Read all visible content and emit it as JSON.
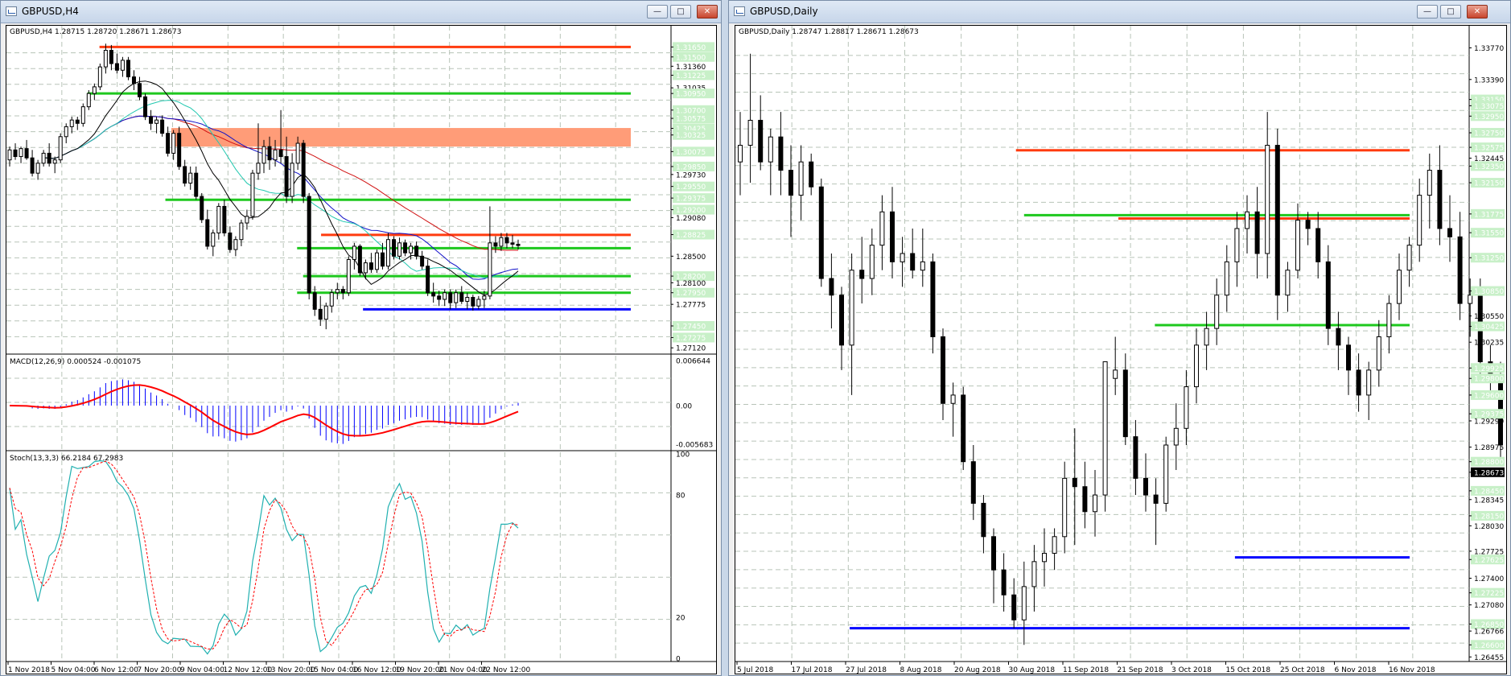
{
  "colors": {
    "bull": "#ffffff",
    "bear": "#000000",
    "resistance": "#ff3b0f",
    "support_green": "#1ec81e",
    "support_blue": "#0000ff",
    "zone": "#ff9c78",
    "grid": "#b8c4b8",
    "price_label_bg": "#c8f0c8",
    "ma_black": "#000000",
    "ma_blue": "#1010c8",
    "ma_red": "#d01010",
    "ma_teal": "#22c8b0",
    "macd_hist": "#0000ff",
    "macd_signal": "#ff0000",
    "stoch_main": "#20b0b0",
    "stoch_signal": "#ff0000"
  },
  "left": {
    "window_title": "GBPUSD,H4",
    "buttons": {
      "minimize": "—",
      "maximize": "□",
      "close": "✕"
    },
    "chart_header": "GBPUSD,H4  1.28715 1.28720 1.28671 1.28673",
    "macd_header": "MACD(12,26,9) 0.000524 -0.001075",
    "stoch_header": "Stoch(13,3,3) 66.2184 67.2983",
    "price_labels": [
      "1.31650",
      "1.31500",
      "1.31360",
      "1.31225",
      "1.31035",
      "1.30950",
      "1.30700",
      "1.30575",
      "1.30425",
      "1.30325",
      "1.30075",
      "1.29850",
      "1.29730",
      "1.29550",
      "1.29375",
      "1.29200",
      "1.29080",
      "1.28825",
      "1.28500",
      "1.28200",
      "1.28100",
      "1.27950",
      "1.27775",
      "1.27450",
      "1.27275",
      "1.27120"
    ],
    "price_labels_hl": [
      0,
      1,
      3,
      5,
      6,
      7,
      8,
      9,
      10,
      11,
      13,
      14,
      15,
      17,
      19,
      21,
      23,
      24
    ],
    "price_range": [
      1.2705,
      1.318
    ],
    "current_price": 1.28673,
    "macd_labels": [
      "0.006644",
      "0.00",
      "-0.005683"
    ],
    "stoch_labels": [
      "100",
      "80",
      "20",
      "0"
    ],
    "x_labels": [
      "1 Nov 2018",
      "5 Nov 04:00",
      "6 Nov 12:00",
      "7 Nov 20:00",
      "9 Nov 04:00",
      "12 Nov 12:00",
      "13 Nov 20:00",
      "15 Nov 04:00",
      "16 Nov 12:00",
      "19 Nov 20:00",
      "21 Nov 04:00",
      "22 Nov 12:00"
    ],
    "hlines": [
      {
        "price": 1.3165,
        "color": "resistance",
        "from": 0.3
      },
      {
        "price": 1.3095,
        "color": "support_green",
        "from": 0.26
      },
      {
        "price": 1.2935,
        "color": "support_green",
        "from": 0.52
      },
      {
        "price": 1.2882,
        "color": "resistance",
        "from": 1.04
      },
      {
        "price": 1.2862,
        "color": "support_green",
        "from": 0.96
      },
      {
        "price": 1.282,
        "color": "support_green",
        "from": 0.98
      },
      {
        "price": 1.2795,
        "color": "support_green",
        "from": 0.96
      },
      {
        "price": 1.277,
        "color": "support_blue",
        "from": 1.18
      }
    ],
    "zone": {
      "from": 1.3043,
      "to": 1.3015,
      "start": 0.54
    },
    "candles": [
      [
        1.2995,
        1.3015,
        1.2985,
        1.301
      ],
      [
        1.301,
        1.302,
        1.2995,
        1.3
      ],
      [
        1.3,
        1.3015,
        1.299,
        1.3012
      ],
      [
        1.3012,
        1.3025,
        1.2995,
        1.2998
      ],
      [
        1.2998,
        1.301,
        1.297,
        1.2975
      ],
      [
        1.2975,
        1.2995,
        1.2965,
        1.299
      ],
      [
        1.299,
        1.301,
        1.2985,
        1.3005
      ],
      [
        1.3005,
        1.302,
        1.2985,
        1.299
      ],
      [
        1.299,
        1.3,
        1.2975,
        1.2995
      ],
      [
        1.2995,
        1.3035,
        1.299,
        1.303
      ],
      [
        1.303,
        1.305,
        1.302,
        1.3045
      ],
      [
        1.3045,
        1.306,
        1.3035,
        1.3055
      ],
      [
        1.3055,
        1.306,
        1.304,
        1.305
      ],
      [
        1.305,
        1.308,
        1.3045,
        1.3075
      ],
      [
        1.3075,
        1.31,
        1.307,
        1.3095
      ],
      [
        1.3095,
        1.311,
        1.3085,
        1.3105
      ],
      [
        1.3105,
        1.314,
        1.31,
        1.3135
      ],
      [
        1.3135,
        1.317,
        1.3125,
        1.316
      ],
      [
        1.316,
        1.3168,
        1.313,
        1.314
      ],
      [
        1.314,
        1.3155,
        1.3125,
        1.313
      ],
      [
        1.313,
        1.315,
        1.312,
        1.3145
      ],
      [
        1.3145,
        1.315,
        1.3115,
        1.312
      ],
      [
        1.312,
        1.313,
        1.31,
        1.311
      ],
      [
        1.311,
        1.312,
        1.3085,
        1.309
      ],
      [
        1.309,
        1.3095,
        1.3055,
        1.306
      ],
      [
        1.306,
        1.307,
        1.304,
        1.305
      ],
      [
        1.305,
        1.306,
        1.3035,
        1.3055
      ],
      [
        1.3055,
        1.3062,
        1.303,
        1.3035
      ],
      [
        1.3035,
        1.3045,
        1.3,
        1.3005
      ],
      [
        1.3005,
        1.304,
        1.2995,
        1.3035
      ],
      [
        1.3035,
        1.3045,
        1.298,
        1.2985
      ],
      [
        1.2985,
        1.2995,
        1.2955,
        1.296
      ],
      [
        1.296,
        1.2985,
        1.295,
        1.2975
      ],
      [
        1.2975,
        1.2985,
        1.2935,
        1.294
      ],
      [
        1.294,
        1.2945,
        1.29,
        1.2905
      ],
      [
        1.2905,
        1.292,
        1.286,
        1.2865
      ],
      [
        1.2865,
        1.289,
        1.285,
        1.2885
      ],
      [
        1.2885,
        1.293,
        1.2875,
        1.2925
      ],
      [
        1.2925,
        1.2935,
        1.288,
        1.2885
      ],
      [
        1.2885,
        1.2895,
        1.2855,
        1.286
      ],
      [
        1.286,
        1.288,
        1.285,
        1.2875
      ],
      [
        1.2875,
        1.2905,
        1.2865,
        1.29
      ],
      [
        1.29,
        1.292,
        1.289,
        1.291
      ],
      [
        1.291,
        1.298,
        1.2905,
        1.2975
      ],
      [
        1.2975,
        1.305,
        1.2965,
        1.299
      ],
      [
        1.299,
        1.3025,
        1.2975,
        1.3015
      ],
      [
        1.3015,
        1.303,
        1.298,
        1.2995
      ],
      [
        1.2995,
        1.3025,
        1.2985,
        1.301
      ],
      [
        1.301,
        1.307,
        1.299,
        1.3
      ],
      [
        1.3,
        1.303,
        1.293,
        1.294
      ],
      [
        1.294,
        1.3005,
        1.293,
        1.299
      ],
      [
        1.299,
        1.303,
        1.298,
        1.302
      ],
      [
        1.302,
        1.3025,
        1.293,
        1.294
      ],
      [
        1.294,
        1.2945,
        1.2785,
        1.2795
      ],
      [
        1.2795,
        1.2805,
        1.276,
        1.277
      ],
      [
        1.277,
        1.279,
        1.2745,
        1.2755
      ],
      [
        1.2755,
        1.278,
        1.274,
        1.2775
      ],
      [
        1.2775,
        1.28,
        1.2765,
        1.2795
      ],
      [
        1.2795,
        1.281,
        1.2785,
        1.28
      ],
      [
        1.28,
        1.2805,
        1.2785,
        1.2795
      ],
      [
        1.2795,
        1.285,
        1.279,
        1.2845
      ],
      [
        1.2845,
        1.287,
        1.283,
        1.2865
      ],
      [
        1.2865,
        1.2868,
        1.282,
        1.2825
      ],
      [
        1.2825,
        1.2845,
        1.2815,
        1.284
      ],
      [
        1.284,
        1.2855,
        1.2825,
        1.283
      ],
      [
        1.283,
        1.286,
        1.2825,
        1.2855
      ],
      [
        1.2855,
        1.287,
        1.283,
        1.2835
      ],
      [
        1.2835,
        1.2885,
        1.283,
        1.2875
      ],
      [
        1.2875,
        1.288,
        1.2845,
        1.285
      ],
      [
        1.285,
        1.2878,
        1.2845,
        1.287
      ],
      [
        1.287,
        1.2875,
        1.285,
        1.2855
      ],
      [
        1.2855,
        1.287,
        1.2845,
        1.2865
      ],
      [
        1.2865,
        1.2872,
        1.2845,
        1.285
      ],
      [
        1.285,
        1.2858,
        1.283,
        1.2835
      ],
      [
        1.2835,
        1.2845,
        1.279,
        1.2795
      ],
      [
        1.2795,
        1.281,
        1.278,
        1.279
      ],
      [
        1.279,
        1.2798,
        1.2775,
        1.2785
      ],
      [
        1.2785,
        1.28,
        1.2775,
        1.2795
      ],
      [
        1.2795,
        1.28,
        1.277,
        1.278
      ],
      [
        1.278,
        1.28,
        1.2772,
        1.2795
      ],
      [
        1.2795,
        1.2805,
        1.2778,
        1.2782
      ],
      [
        1.2782,
        1.2795,
        1.277,
        1.2788
      ],
      [
        1.2788,
        1.2792,
        1.2768,
        1.2775
      ],
      [
        1.2775,
        1.279,
        1.277,
        1.2785
      ],
      [
        1.2785,
        1.2798,
        1.2772,
        1.279
      ],
      [
        1.279,
        1.2925,
        1.2785,
        1.287
      ],
      [
        1.287,
        1.288,
        1.2855,
        1.2865
      ],
      [
        1.2865,
        1.2885,
        1.2858,
        1.2878
      ],
      [
        1.2878,
        1.2885,
        1.2862,
        1.287
      ],
      [
        1.287,
        1.2882,
        1.2862,
        1.2868
      ],
      [
        1.2868,
        1.2875,
        1.286,
        1.2866
      ]
    ]
  },
  "right": {
    "window_title": "GBPUSD,Daily",
    "buttons": {
      "minimize": "—",
      "maximize": "□",
      "close": "✕"
    },
    "chart_header": "GBPUSD,Daily  1.28747 1.28817 1.28671 1.28673",
    "price_labels": [
      "1.33770",
      "1.33390",
      "1.33150",
      "1.33075",
      "1.32950",
      "1.32750",
      "1.32575",
      "1.32445",
      "1.32350",
      "1.32150",
      "1.31775",
      "1.31550",
      "1.31250",
      "1.30850",
      "1.30550",
      "1.30425",
      "1.30235",
      "1.29925",
      "1.29800",
      "1.29600",
      "1.29375",
      "1.29290",
      "1.28975",
      "1.28800",
      "1.28673",
      "1.28450",
      "1.28345",
      "1.28150",
      "1.28030",
      "1.27725",
      "1.27625",
      "1.27400",
      "1.27225",
      "1.27080",
      "1.26850",
      "1.26766",
      "1.26600",
      "1.26455"
    ],
    "price_labels_hl": [
      2,
      3,
      4,
      5,
      6,
      8,
      9,
      10,
      11,
      12,
      13,
      15,
      17,
      18,
      19,
      20,
      23,
      25,
      27,
      30,
      32,
      34,
      36
    ],
    "price_range": [
      1.264,
      1.339
    ],
    "current_price": 1.28673,
    "x_labels": [
      "5 Jul 2018",
      "17 Jul 2018",
      "27 Jul 2018",
      "8 Aug 2018",
      "20 Aug 2018",
      "30 Aug 2018",
      "11 Sep 2018",
      "21 Sep 2018",
      "3 Oct 2018",
      "15 Oct 2018",
      "25 Oct 2018",
      "6 Nov 2018",
      "16 Nov 2018"
    ],
    "hlines": [
      {
        "price": 1.3254,
        "color": "resistance",
        "from": 27.2
      },
      {
        "price": 1.3172,
        "color": "resistance",
        "from": 37.3
      },
      {
        "price": 1.3176,
        "color": "support_green",
        "from": 28.0
      },
      {
        "price": 1.3044,
        "color": "support_green",
        "from": 40.9
      },
      {
        "price": 1.2765,
        "color": "support_blue",
        "from": 48.8
      },
      {
        "price": 1.268,
        "color": "support_blue",
        "from": 10.8
      }
    ],
    "candles": [
      [
        1.324,
        1.33,
        1.32,
        1.326
      ],
      [
        1.326,
        1.337,
        1.3215,
        1.329
      ],
      [
        1.329,
        1.332,
        1.323,
        1.324
      ],
      [
        1.324,
        1.328,
        1.32,
        1.327
      ],
      [
        1.327,
        1.33,
        1.32,
        1.323
      ],
      [
        1.323,
        1.326,
        1.315,
        1.32
      ],
      [
        1.32,
        1.326,
        1.317,
        1.324
      ],
      [
        1.324,
        1.325,
        1.32,
        1.321
      ],
      [
        1.321,
        1.322,
        1.309,
        1.31
      ],
      [
        1.31,
        1.313,
        1.304,
        1.308
      ],
      [
        1.308,
        1.309,
        1.299,
        1.302
      ],
      [
        1.302,
        1.313,
        1.296,
        1.311
      ],
      [
        1.311,
        1.315,
        1.307,
        1.31
      ],
      [
        1.31,
        1.316,
        1.308,
        1.314
      ],
      [
        1.314,
        1.32,
        1.311,
        1.318
      ],
      [
        1.318,
        1.321,
        1.31,
        1.312
      ],
      [
        1.312,
        1.315,
        1.309,
        1.313
      ],
      [
        1.313,
        1.316,
        1.31,
        1.311
      ],
      [
        1.311,
        1.316,
        1.309,
        1.312
      ],
      [
        1.312,
        1.313,
        1.301,
        1.303
      ],
      [
        1.303,
        1.304,
        1.293,
        1.295
      ],
      [
        1.295,
        1.2975,
        1.291,
        1.296
      ],
      [
        1.296,
        1.297,
        1.287,
        1.288
      ],
      [
        1.288,
        1.29,
        1.281,
        1.283
      ],
      [
        1.283,
        1.284,
        1.277,
        1.279
      ],
      [
        1.279,
        1.28,
        1.271,
        1.275
      ],
      [
        1.275,
        1.277,
        1.27,
        1.272
      ],
      [
        1.272,
        1.274,
        1.268,
        1.269
      ],
      [
        1.269,
        1.276,
        1.266,
        1.273
      ],
      [
        1.273,
        1.278,
        1.27,
        1.276
      ],
      [
        1.276,
        1.28,
        1.273,
        1.277
      ],
      [
        1.277,
        1.28,
        1.275,
        1.279
      ],
      [
        1.279,
        1.288,
        1.277,
        1.286
      ],
      [
        1.286,
        1.292,
        1.278,
        1.285
      ],
      [
        1.285,
        1.288,
        1.28,
        1.282
      ],
      [
        1.282,
        1.287,
        1.279,
        1.284
      ],
      [
        1.284,
        1.295,
        1.282,
        1.3
      ],
      [
        1.298,
        1.303,
        1.296,
        1.299
      ],
      [
        1.299,
        1.301,
        1.29,
        1.291
      ],
      [
        1.291,
        1.293,
        1.284,
        1.286
      ],
      [
        1.286,
        1.289,
        1.282,
        1.284
      ],
      [
        1.284,
        1.286,
        1.278,
        1.283
      ],
      [
        1.283,
        1.291,
        1.282,
        1.29
      ],
      [
        1.29,
        1.295,
        1.287,
        1.292
      ],
      [
        1.292,
        1.299,
        1.29,
        1.297
      ],
      [
        1.297,
        1.304,
        1.295,
        1.302
      ],
      [
        1.302,
        1.306,
        1.299,
        1.304
      ],
      [
        1.304,
        1.31,
        1.302,
        1.308
      ],
      [
        1.308,
        1.314,
        1.306,
        1.312
      ],
      [
        1.312,
        1.318,
        1.309,
        1.316
      ],
      [
        1.316,
        1.32,
        1.313,
        1.318
      ],
      [
        1.318,
        1.321,
        1.31,
        1.313
      ],
      [
        1.313,
        1.33,
        1.31,
        1.326
      ],
      [
        1.326,
        1.328,
        1.305,
        1.308
      ],
      [
        1.308,
        1.312,
        1.306,
        1.311
      ],
      [
        1.311,
        1.319,
        1.31,
        1.317
      ],
      [
        1.317,
        1.318,
        1.314,
        1.316
      ],
      [
        1.316,
        1.318,
        1.31,
        1.312
      ],
      [
        1.312,
        1.314,
        1.302,
        1.304
      ],
      [
        1.304,
        1.306,
        1.299,
        1.302
      ],
      [
        1.302,
        1.303,
        1.296,
        1.299
      ],
      [
        1.299,
        1.301,
        1.294,
        1.296
      ],
      [
        1.296,
        1.3,
        1.293,
        1.299
      ],
      [
        1.299,
        1.305,
        1.297,
        1.303
      ],
      [
        1.303,
        1.308,
        1.301,
        1.307
      ],
      [
        1.307,
        1.313,
        1.305,
        1.311
      ],
      [
        1.311,
        1.315,
        1.309,
        1.314
      ],
      [
        1.314,
        1.322,
        1.312,
        1.32
      ],
      [
        1.32,
        1.325,
        1.316,
        1.323
      ],
      [
        1.323,
        1.326,
        1.314,
        1.316
      ],
      [
        1.316,
        1.32,
        1.312,
        1.315
      ],
      [
        1.315,
        1.318,
        1.305,
        1.307
      ],
      [
        1.307,
        1.31,
        1.303,
        1.308
      ],
      [
        1.308,
        1.31,
        1.298,
        1.3
      ],
      [
        1.3,
        1.302,
        1.296,
        1.298
      ],
      [
        1.298,
        1.3,
        1.288,
        1.29
      ],
      [
        1.29,
        1.292,
        1.283,
        1.285
      ],
      [
        1.285,
        1.286,
        1.279,
        1.281
      ],
      [
        1.281,
        1.283,
        1.276,
        1.278
      ],
      [
        1.278,
        1.28,
        1.27,
        1.272
      ],
      [
        1.272,
        1.278,
        1.27,
        1.277
      ],
      [
        1.277,
        1.3,
        1.276,
        1.296
      ],
      [
        1.296,
        1.302,
        1.294,
        1.3
      ],
      [
        1.3,
        1.306,
        1.298,
        1.304
      ],
      [
        1.304,
        1.308,
        1.301,
        1.306
      ],
      [
        1.306,
        1.31,
        1.304,
        1.308
      ],
      [
        1.308,
        1.315,
        1.306,
        1.312
      ],
      [
        1.312,
        1.313,
        1.305,
        1.306
      ],
      [
        1.306,
        1.308,
        1.299,
        1.3
      ],
      [
        1.3,
        1.302,
        1.294,
        1.296
      ],
      [
        1.296,
        1.299,
        1.288,
        1.29
      ],
      [
        1.29,
        1.299,
        1.288,
        1.298
      ],
      [
        1.298,
        1.306,
        1.296,
        1.3
      ],
      [
        1.3,
        1.302,
        1.278,
        1.279
      ],
      [
        1.279,
        1.284,
        1.276,
        1.283
      ],
      [
        1.283,
        1.284,
        1.277,
        1.278
      ],
      [
        1.278,
        1.284,
        1.277,
        1.28
      ],
      [
        1.28,
        1.286,
        1.279,
        1.285
      ],
      [
        1.285,
        1.286,
        1.275,
        1.277
      ],
      [
        1.277,
        1.288,
        1.276,
        1.287
      ]
    ]
  }
}
